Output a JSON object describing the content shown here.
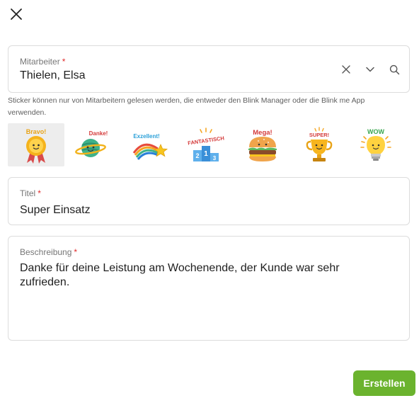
{
  "close": {
    "icon": "close-icon"
  },
  "employee": {
    "label": "Mitarbeiter",
    "required_mark": "*",
    "value": "Thielen, Elsa",
    "actions": [
      "clear-icon",
      "chevron-down-icon",
      "search-icon"
    ]
  },
  "hint": "Sticker können nur von Mitarbeitern gelesen werden, die entweder den Blink Manager oder die Blink me App verwenden.",
  "stickers": [
    {
      "label": "Bravo!",
      "icon": "medal-sticker-icon",
      "selected": true,
      "color": "#f5a623"
    },
    {
      "label": "Danke!",
      "icon": "planet-sticker-icon",
      "selected": false,
      "color": "#3fb28a"
    },
    {
      "label": "Exzellent!",
      "icon": "rainbow-star-sticker-icon",
      "selected": false,
      "color": "#2aa0d8"
    },
    {
      "label": "FANTASTISCH",
      "label2": "2",
      "label3": "1",
      "label4": "3",
      "icon": "podium-sticker-icon",
      "selected": false,
      "color": "#d43a3a"
    },
    {
      "label": "Mega!",
      "icon": "burger-sticker-icon",
      "selected": false,
      "color": "#d43a3a"
    },
    {
      "label": "SUPER!",
      "icon": "trophy-sticker-icon",
      "selected": false,
      "color": "#e8a317"
    },
    {
      "label": "WOW",
      "icon": "lightbulb-sticker-icon",
      "selected": false,
      "color": "#3aa64f"
    }
  ],
  "title_field": {
    "label": "Titel",
    "required_mark": "*",
    "value": "Super Einsatz"
  },
  "description": {
    "label": "Beschreibung",
    "required_mark": "*",
    "value": "Danke für deine Leistung am Wochenende, der Kunde war sehr zufrieden."
  },
  "submit": {
    "label": "Erstellen",
    "color": "#6bb32e"
  }
}
